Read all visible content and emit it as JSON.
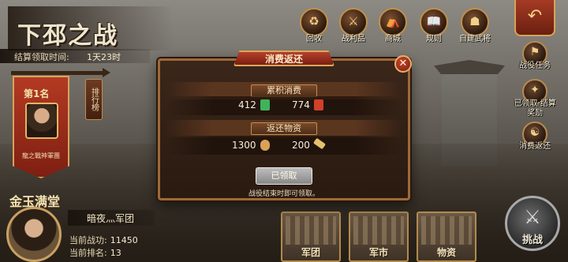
{
  "title": "下邳之战",
  "settlement": {
    "label": "结算领取时间:",
    "value": "1天23时"
  },
  "rank": {
    "label": "第1名",
    "corps": "龍之戰神軍團",
    "leaderboard_label": "排行榜"
  },
  "top_menu": [
    {
      "label": "回收",
      "icon": "recycle-icon"
    },
    {
      "label": "战利品",
      "icon": "spoils-icon"
    },
    {
      "label": "商城",
      "icon": "shop-icon"
    },
    {
      "label": "规则",
      "icon": "rules-book-icon"
    },
    {
      "label": "自建武将",
      "icon": "custom-general-icon"
    }
  ],
  "side_menu": [
    {
      "label": "战役任务",
      "icon": "battle-task-icon"
    },
    {
      "label": "已领取 结算奖励",
      "icon": "settlement-reward-icon"
    },
    {
      "label": "消费返还",
      "icon": "spend-return-icon"
    }
  ],
  "player": {
    "title": "金玉满堂",
    "corps_name": "暗夜灬军团",
    "power_label": "当前战功:",
    "power_value": "11450",
    "rank_label": "当前排名:",
    "rank_value": "13"
  },
  "features": [
    {
      "label": "军团"
    },
    {
      "label": "军市"
    },
    {
      "label": "物资"
    }
  ],
  "challenge_label": "挑战",
  "modal": {
    "title": "消费返还",
    "close_glyph": "✕",
    "section_spend": "累积消费",
    "spend_items": [
      {
        "value": "412",
        "icon": "green-jade-icon",
        "color": "#3fb35a"
      },
      {
        "value": "774",
        "icon": "red-token-icon",
        "color": "#d0402a"
      }
    ],
    "section_return": "返还物资",
    "return_items": [
      {
        "value": "1300",
        "icon": "scroll-icon",
        "color": "#d9a257"
      },
      {
        "value": "200",
        "icon": "brush-icon",
        "color": "#e7c06c"
      }
    ],
    "claim_button": "已领取",
    "note": "战役结束时即可领取。"
  }
}
